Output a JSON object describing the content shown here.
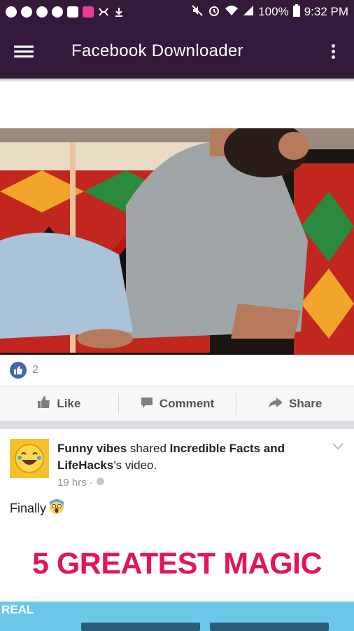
{
  "status_bar": {
    "battery": "100%",
    "time": "9:32 PM"
  },
  "app_bar": {
    "title": "Facebook Downloader",
    "menu_icon": "hamburger-menu-icon",
    "overflow_icon": "more-vert-icon"
  },
  "post1": {
    "like_count": "2",
    "actions": [
      {
        "label": "Like",
        "icon": "thumbs-up-icon"
      },
      {
        "label": "Comment",
        "icon": "comment-icon"
      },
      {
        "label": "Share",
        "icon": "share-icon"
      }
    ]
  },
  "post2": {
    "author": "Funny vibes",
    "verb": "shared",
    "source": "Incredible Facts and LifeHacks",
    "suffix": "'s video.",
    "time": "19 hrs",
    "privacy_icon": "globe-icon",
    "caption": "Finally",
    "video_title": "5 GREATEST MAGIC",
    "video_logo": "REAL"
  },
  "colors": {
    "appbar": "#35193b",
    "facebook_blue": "#4267b2",
    "magic_text": "#e3155a"
  }
}
